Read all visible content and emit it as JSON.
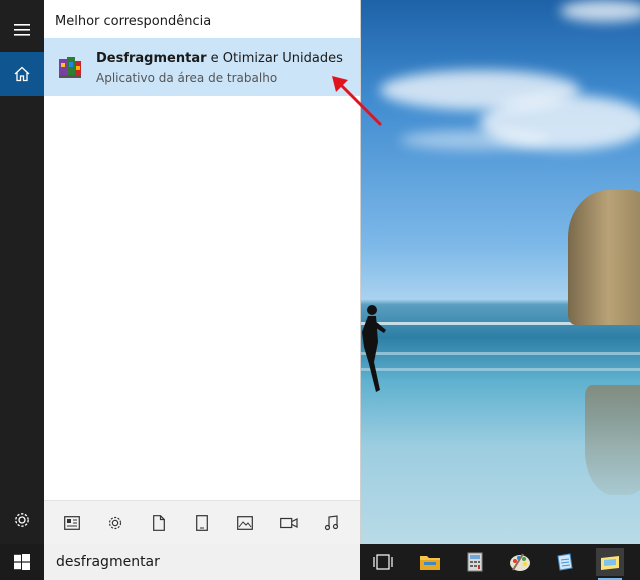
{
  "search_panel": {
    "section_title": "Melhor correspondência",
    "best_match": {
      "title_bold": "Desfragmentar",
      "title_rest": " e Otimizar Unidades",
      "subtitle": "Aplicativo da área de trabalho"
    },
    "filters": [
      "documents-icon",
      "settings-icon",
      "file-icon",
      "tablet-icon",
      "photos-icon",
      "video-icon",
      "music-icon"
    ]
  },
  "rail": {
    "items": [
      "hamburger-icon",
      "home-icon",
      "settings-icon"
    ]
  },
  "taskbar": {
    "search_value": "desfragmentar",
    "apps": [
      "task-view-icon",
      "file-explorer-icon",
      "calculator-icon",
      "paint-icon",
      "notepad-icon",
      "sticky-app-icon"
    ]
  },
  "colors": {
    "accent": "#0f5590",
    "selection": "#cce4f7",
    "annotation": "#e0141e"
  }
}
